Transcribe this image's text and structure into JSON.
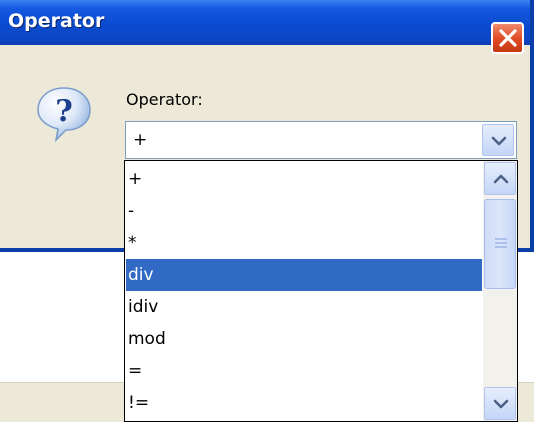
{
  "dialog": {
    "title": "Operator",
    "icons": {
      "close": "close-icon",
      "help": "question-mark-icon"
    }
  },
  "form": {
    "label": "Operator:",
    "selected_value": "+"
  },
  "dropdown": {
    "options": [
      "+",
      "-",
      "*",
      "div",
      "idiv",
      "mod",
      "=",
      "!="
    ],
    "highlighted_index": 3,
    "icons": {
      "open": "chevron-down-icon",
      "scroll_up": "chevron-up-icon",
      "scroll_down": "chevron-down-icon",
      "grip": "grip-icon"
    }
  },
  "colors": {
    "titlebar": "#0a4bd0",
    "highlight": "#316ac5",
    "close_button": "#de4a22",
    "dialog_bg": "#ece9d8"
  }
}
